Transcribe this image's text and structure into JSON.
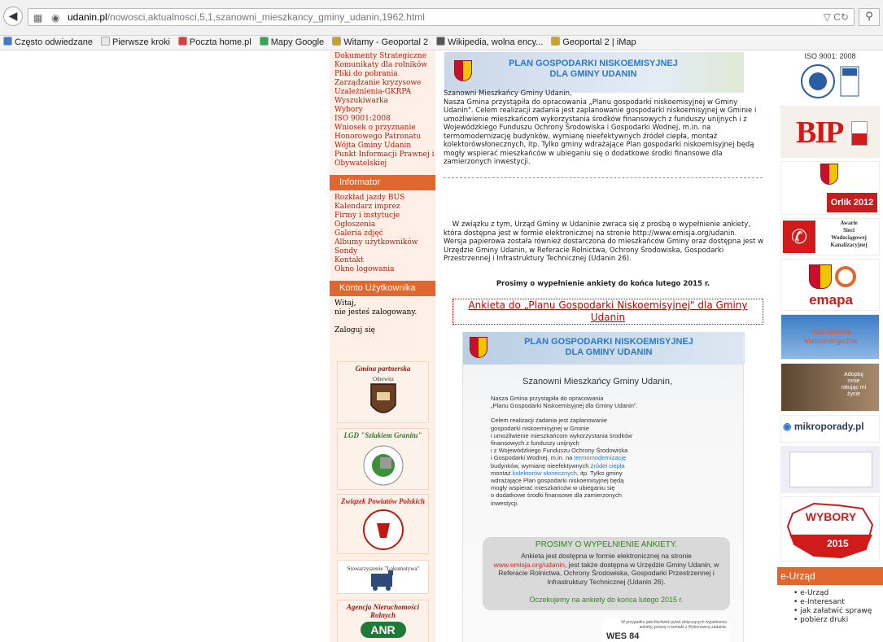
{
  "browser": {
    "url_host": "udanin.pl",
    "url_path": "/nowosci,aktualnosci,5,1,szanowni_mieszkancy_gminy_udanin,1962.html",
    "bookmarks": [
      {
        "label": "Często odwiedzane",
        "color": "#3b7bd8"
      },
      {
        "label": "Pierwsze kroki",
        "color": "#e8e8e8"
      },
      {
        "label": "Poczta home.pl",
        "color": "#d64040"
      },
      {
        "label": "Mapy Google",
        "color": "#3aa357"
      },
      {
        "label": "Witamy - Geoportal 2",
        "color": "#c9a227"
      },
      {
        "label": "Wikipedia, wolna ency...",
        "color": "#555555"
      },
      {
        "label": "Geoportal 2 | iMap",
        "color": "#c9a227"
      }
    ]
  },
  "left_menu": {
    "links_top": [
      "Dokumenty Strategiczne",
      "Komunikaty dla rolników",
      "Pliki do pobrania",
      "Zarządzanie kryzysowe",
      "Uzależnienia-GKRPA",
      "Wyszukiwarka",
      "Wybory",
      "ISO 9001:2008",
      "Wniosek o przyznanie",
      "Honorowego Patronatu",
      "Wójta Gminy Udanin",
      "Punkt Informacji Prawnej i",
      "Obywatelskiej"
    ],
    "informator_head": "Informator",
    "informator_links": [
      "Rozkład jazdy BUS",
      "Kalendarz imprez",
      "Firmy i instytucje",
      "Ogłoszenia",
      "Galeria zdjęć",
      "Albumy użytkowników",
      "Sondy",
      "Kontakt",
      "Okno logowania"
    ],
    "account_head": "Konto Użytkownika",
    "welcome": "Witaj,",
    "not_logged": "nie jesteś zalogowany.",
    "login": "Zaloguj się",
    "partners": [
      {
        "title": "Gmina partnerska",
        "img": "Oderwitz"
      },
      {
        "title": "LGD \"Szlakiem Granitu\""
      },
      {
        "title": "Związek Powiatów Polskich"
      },
      {
        "title": "",
        "img": "Stowarzyszenie \"Lokomotywa\""
      },
      {
        "title": "Agencja Nieruchomości Rolnych",
        "img": "ANR"
      }
    ]
  },
  "main": {
    "banner_title": "PLAN GOSPODARKI NISKOEMISYJNEJ\nDLA GMINY UDANIN",
    "p1": "Szanowni Mieszkańcy Gminy Udanin,\nNasza Gmina przystąpiła do opracowania „Planu gospodarki niskoemisyjnej w Gminy\nUdanin\". Celem realizacji zadania jest zaplanowanie gospodarki niskoemisyjnej w Gminie i\numożliwienie mieszkańcom wykorzystania środków finansowych z funduszy unijnych i z\nWojewódzkiego Funduszu Ochrony Środowiska i Gospodarki Wodnej, m.in. na\ntermomodernizację budynków, wymianę nieefektywnych źródeł ciepła, montaż\nkolektorówsłonecznych, itp. Tylko gminy wdrażające Plan gospodarki niskoemisyjnej będą\nmogły wspierać mieszkańców w ubieganiu się o dodatkowe środki finansowe dla\nzamierzonych inwestycji.",
    "p2": "    W związku z tym, Urząd Gminy w Udaninie zwraca się z prośbą o wypełnienie ankiety,\nktóra dostępna jest w formie elektronicznej na stronie http://www.emisja.org/udanin.\nWersja papierowa została również dostarczona do mieszkańców Gminy oraz dostępna jest w\nUrzędzie Gminy Udanin, w Referacie Rolnictwa, Ochrony Środowiska, Gospodarki\nPrzestrzennej i Infrastruktury Technicznej (Udanin 26).",
    "p3": "Prosimy o wypełnienie ankiety do końca lutego 2015 r.",
    "anketa_link": "Ankieta do „Planu Gospodarki Niskoemisyjnej\" dla Gminy\nUdanin",
    "poster": {
      "greeting": "Szanowni Mieszkańcy Gminy Udanin,",
      "lines_a": [
        "Nasza Gmina przystąpiła do opracowania",
        "„Planu Gospodarki Niskoemisyjnej dla Gminy Udanin\"."
      ],
      "lines_b": [
        "Celem realizacji zadania jest zaplanowanie",
        "gospodarki niskoemisyjnej w Gminie",
        "i umożliwienie mieszkańcom wykorzystania środków",
        "finansowych z funduszy unijnych",
        "i z Wojewódzkiego Funduszu Ochrony Środowiska"
      ],
      "line_gw": "i Gospodarki Wodnej, m.in. na ",
      "line_gw_link": "termomodernizację",
      "line_bud": "budynków, wymianę nieefektywnych ",
      "line_bud_link": "źródeł ciepła",
      "line_mont": "montaż ",
      "line_mont_link": "kolektorów słonecznych",
      "line_mont_tail": ", itp. Tylko gminy",
      "lines_c": [
        "wdrażające Plan gospodarki niskoemisyjnej będą",
        "mogły wspierać mieszkańców w ubieganiu się",
        "o dodatkowe środki finansowe dla zamierzonych",
        "inwestycji."
      ],
      "green_title": "PROSIMY O WYPEŁNIENIE ANKIETY.",
      "green_text_1": "Ankieta jest dostępna w formie elektronicznej na stronie",
      "green_link": "www.emisja.org/udanin",
      "green_text_2": ", jest także dostępna w Urzędzie Gminy Udanin, w Referacie Rolnictwa, Ochrony Środowiska, Gospodarki Przestrzennej i Infrastruktury Technicznej (Udanin 26).",
      "green_foot": "Oczekujemy na ankiety do końca lutego 2015 r.",
      "wes_note": "W przypadku jakichkolwiek pytań dotyczących wypełnienia ankiety, proszę o kontakt z Wykonawcą zadania:",
      "wes_logo": "WES 84"
    }
  },
  "right_col": {
    "iso": "ISO 9001: 2008",
    "bip": "BIP",
    "orlik": "Orlik 2012",
    "awarie": "Awarie\nSieci\nWodociągowej\nKanalizacyjnej",
    "emapa": "emapa",
    "ostrzezenia": "Ostrzeżenia\nMeteorologiczne",
    "adopt": "Adoptuj\nmnie\nratując mi\nżycie",
    "mikroporady": "mikroporady.pl",
    "wybory": "WYBORY",
    "wybory_year": "2015",
    "eurzad_head": "e-Urząd",
    "eurzad_items": [
      "e-Urząd",
      "e-Interesant",
      "jak załatwić sprawę",
      "pobierz druki"
    ]
  }
}
